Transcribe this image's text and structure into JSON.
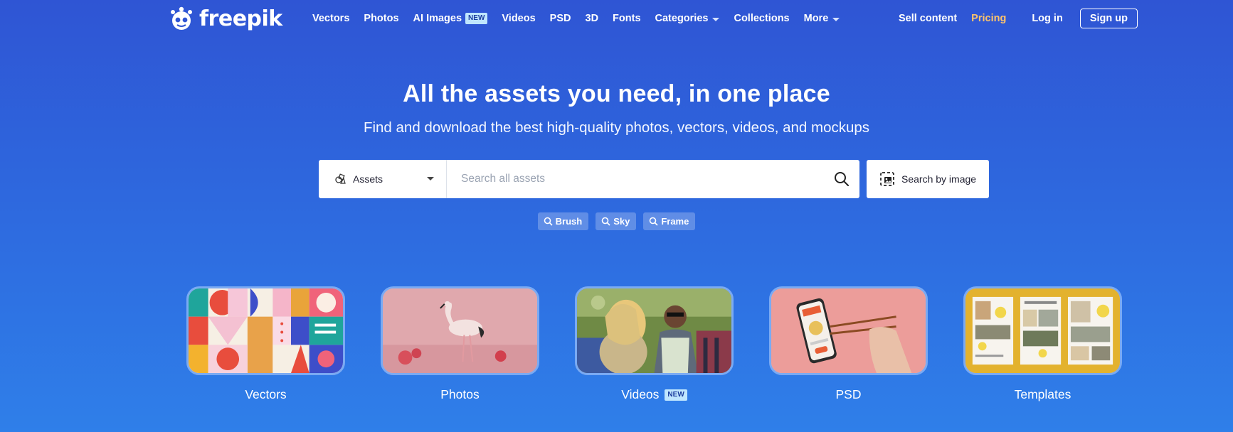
{
  "brand": {
    "name": "freepik"
  },
  "nav": {
    "links": [
      {
        "label": "Vectors"
      },
      {
        "label": "Photos"
      },
      {
        "label": "AI Images",
        "badge": "NEW"
      },
      {
        "label": "Videos"
      },
      {
        "label": "PSD"
      },
      {
        "label": "3D"
      },
      {
        "label": "Fonts"
      },
      {
        "label": "Categories",
        "dropdown": true
      },
      {
        "label": "Collections"
      },
      {
        "label": "More",
        "dropdown": true
      }
    ],
    "sell_content": "Sell content",
    "pricing": "Pricing",
    "login": "Log in",
    "signup": "Sign up",
    "pricing_color": "#ffc46b"
  },
  "hero": {
    "title": "All the assets you need, in one place",
    "subtitle": "Find and download the best high-quality photos, vectors, videos, and mockups"
  },
  "search": {
    "category": "Assets",
    "placeholder": "Search all assets",
    "value": "",
    "image_search_label": "Search by image"
  },
  "suggested_tags": [
    "Brush",
    "Sky",
    "Frame"
  ],
  "categories": [
    {
      "label": "Vectors",
      "icon": "vectors-thumbnail"
    },
    {
      "label": "Photos",
      "icon": "flamingo-thumbnail"
    },
    {
      "label": "Videos",
      "badge": "NEW",
      "icon": "dancing-people-thumbnail"
    },
    {
      "label": "PSD",
      "icon": "phone-mockup-thumbnail"
    },
    {
      "label": "Templates",
      "icon": "templates-thumbnail"
    }
  ],
  "colors": {
    "background_top": "#2f55d4",
    "background_bottom": "#2f7fe9",
    "accent_pricing": "#ffc46b",
    "badge_new_bg": "#bfe6ff"
  }
}
